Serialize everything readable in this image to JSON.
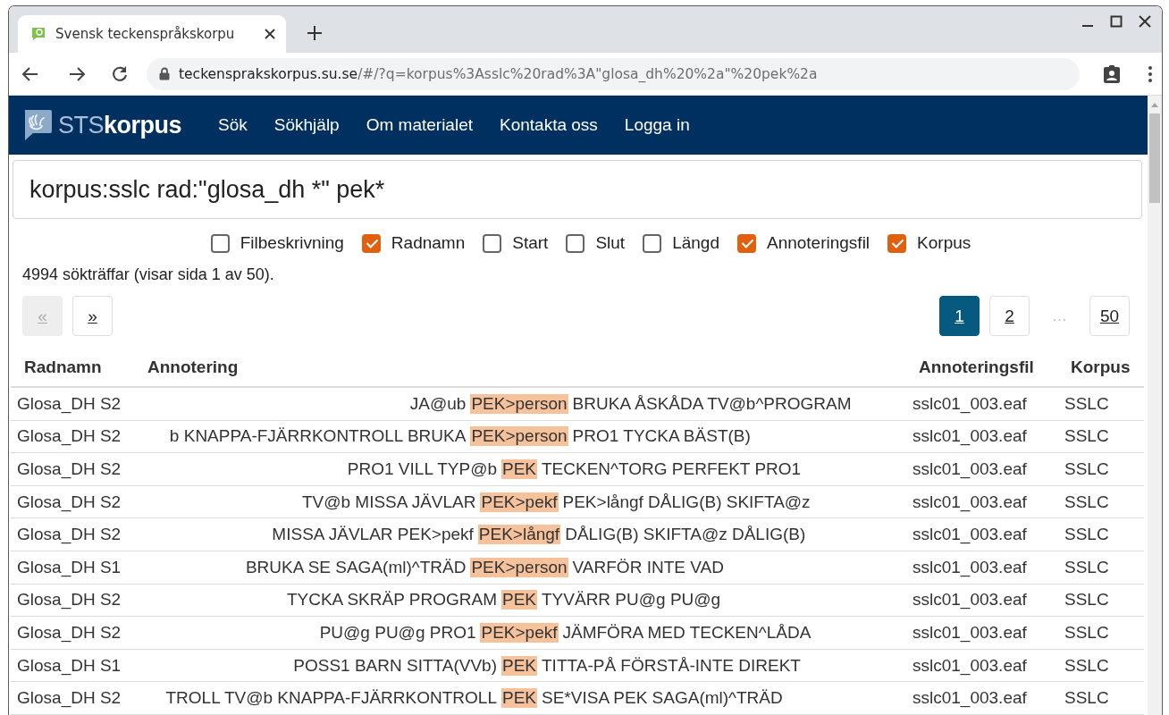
{
  "browser": {
    "tab": {
      "title": "Svensk teckenspråkskorpu",
      "selected": true
    },
    "url": {
      "host": "teckensprakskorpus.su.se",
      "path": "/#/?q=korpus%3Asslc%20rad%3A\"glosa_dh%20%2a\"%20pek%2a"
    }
  },
  "site_nav": {
    "logo": {
      "prefix": "STS",
      "name": "korpus"
    },
    "links": [
      "Sök",
      "Sökhjälp",
      "Om materialet",
      "Kontakta oss",
      "Logga in"
    ]
  },
  "search": {
    "value": "korpus:sslc rad:\"glosa_dh *\" pek*"
  },
  "column_toggles": [
    {
      "label": "Filbeskrivning",
      "checked": false
    },
    {
      "label": "Radnamn",
      "checked": true
    },
    {
      "label": "Start",
      "checked": false
    },
    {
      "label": "Slut",
      "checked": false
    },
    {
      "label": "Längd",
      "checked": false
    },
    {
      "label": "Annoteringsfil",
      "checked": true
    },
    {
      "label": "Korpus",
      "checked": true
    }
  ],
  "result_count": "4994 sökträffar (visar sida 1 av 50).",
  "pager": {
    "prev": {
      "label": "«",
      "disabled": true
    },
    "next": {
      "label": "»",
      "disabled": false
    },
    "pages": [
      {
        "kind": "page",
        "label": "1",
        "selected": true
      },
      {
        "kind": "page",
        "label": "2",
        "selected": false
      },
      {
        "kind": "ellipsis",
        "label": "…"
      },
      {
        "kind": "page",
        "label": "50",
        "selected": false
      }
    ]
  },
  "table": {
    "columns": [
      "Radnamn",
      "Annotering",
      "Annoteringsfil",
      "Korpus"
    ],
    "rows": [
      {
        "radnamn": "Glosa_DH S2",
        "annotation": {
          "left": "JA@ub",
          "match": "PEK>person",
          "right": "BRUKA ÅSKÅDA TV@b^PROGRAM"
        },
        "file": "sslc01_003.eaf",
        "corpus": "SSLC"
      },
      {
        "radnamn": "Glosa_DH S2",
        "annotation": {
          "left": "b KNAPPA-FJÄRRKONTROLL BRUKA",
          "match": "PEK>person",
          "right": "PRO1 TYCKA BÄST(B)"
        },
        "file": "sslc01_003.eaf",
        "corpus": "SSLC"
      },
      {
        "radnamn": "Glosa_DH S2",
        "annotation": {
          "left": "PRO1 VILL TYP@b",
          "match": "PEK",
          "right": "TECKEN^TORG PERFEKT PRO1"
        },
        "file": "sslc01_003.eaf",
        "corpus": "SSLC"
      },
      {
        "radnamn": "Glosa_DH S2",
        "annotation": {
          "left": "TV@b MISSA JÄVLAR",
          "match": "PEK>pekf",
          "right": "PEK>långf DÅLIG(B) SKIFTA@z"
        },
        "file": "sslc01_003.eaf",
        "corpus": "SSLC"
      },
      {
        "radnamn": "Glosa_DH S2",
        "annotation": {
          "left": "MISSA JÄVLAR PEK>pekf",
          "match": "PEK>långf",
          "right": "DÅLIG(B) SKIFTA@z DÅLIG(B)"
        },
        "file": "sslc01_003.eaf",
        "corpus": "SSLC"
      },
      {
        "radnamn": "Glosa_DH S1",
        "annotation": {
          "left": "BRUKA SE SAGA(ml)^TRÄD",
          "match": "PEK>person",
          "right": "VARFÖR INTE VAD"
        },
        "file": "sslc01_003.eaf",
        "corpus": "SSLC"
      },
      {
        "radnamn": "Glosa_DH S2",
        "annotation": {
          "left": "TYCKA SKRÄP PROGRAM",
          "match": "PEK",
          "right": "TYVÄRR PU@g PU@g"
        },
        "file": "sslc01_003.eaf",
        "corpus": "SSLC"
      },
      {
        "radnamn": "Glosa_DH S2",
        "annotation": {
          "left": "PU@g PU@g PRO1",
          "match": "PEK>pekf",
          "right": "JÄMFÖRA MED TECKEN^LÅDA"
        },
        "file": "sslc01_003.eaf",
        "corpus": "SSLC"
      },
      {
        "radnamn": "Glosa_DH S1",
        "annotation": {
          "left": "POSS1 BARN SITTA(VVb)",
          "match": "PEK",
          "right": "TITTA-PÅ FÖRSTÅ-INTE DIREKT"
        },
        "file": "sslc01_003.eaf",
        "corpus": "SSLC"
      },
      {
        "radnamn": "Glosa_DH S2",
        "annotation": {
          "left": "TROLL TV@b KNAPPA-FJÄRRKONTROLL",
          "match": "PEK",
          "right": "SE*VISA PEK SAGA(ml)^TRÄD"
        },
        "file": "sslc01_003.eaf",
        "corpus": "SSLC"
      }
    ]
  }
}
